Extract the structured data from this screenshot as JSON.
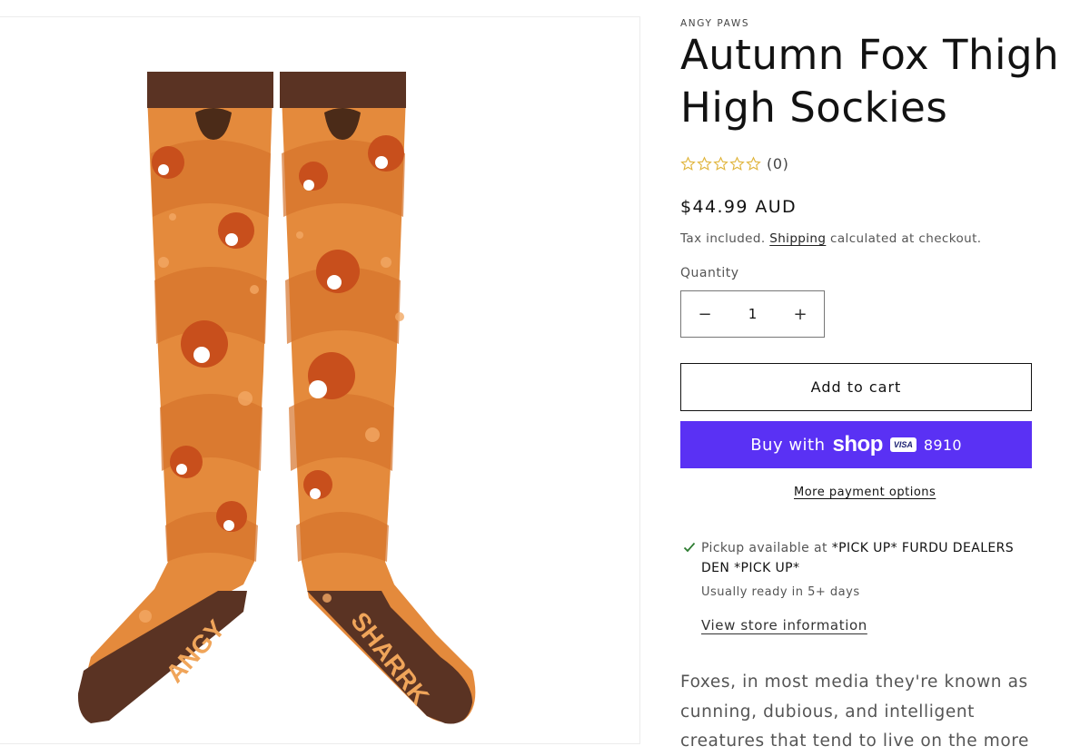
{
  "product": {
    "vendor": "ANGY PAWS",
    "title": "Autumn Fox Thigh High Sockies",
    "rating_count": "(0)",
    "stars_filled": 0,
    "stars_total": 5,
    "price": "$44.99 AUD",
    "tax_prefix": "Tax included.",
    "shipping_link": "Shipping",
    "tax_suffix": "calculated at checkout."
  },
  "quantity": {
    "label": "Quantity",
    "value": "1",
    "decrease": "−",
    "increase": "+"
  },
  "buttons": {
    "add_to_cart": "Add to cart",
    "buy_with": "Buy with",
    "shop_word": "shop",
    "card_brand": "VISA",
    "card_digits": "8910",
    "more_payment": "More payment options"
  },
  "pickup": {
    "prefix": "Pickup available at",
    "location": "*PICK UP* FURDU DEALERS DEN *PICK UP*",
    "ready": "Usually ready in 5+ days",
    "store_link": "View store information"
  },
  "description": "Foxes, in most media they're known as cunning, dubious, and intelligent creatures that tend to live on the more morally questionable side...",
  "sock_text": {
    "left_sole": "ANGY",
    "right_sole": "SHARRK"
  },
  "colors": {
    "shop_pay": "#5a31f4",
    "sock_orange": "#e48a3c",
    "sock_brown": "#5a3323",
    "star": "#e0b43a",
    "check": "#2e7d32"
  }
}
